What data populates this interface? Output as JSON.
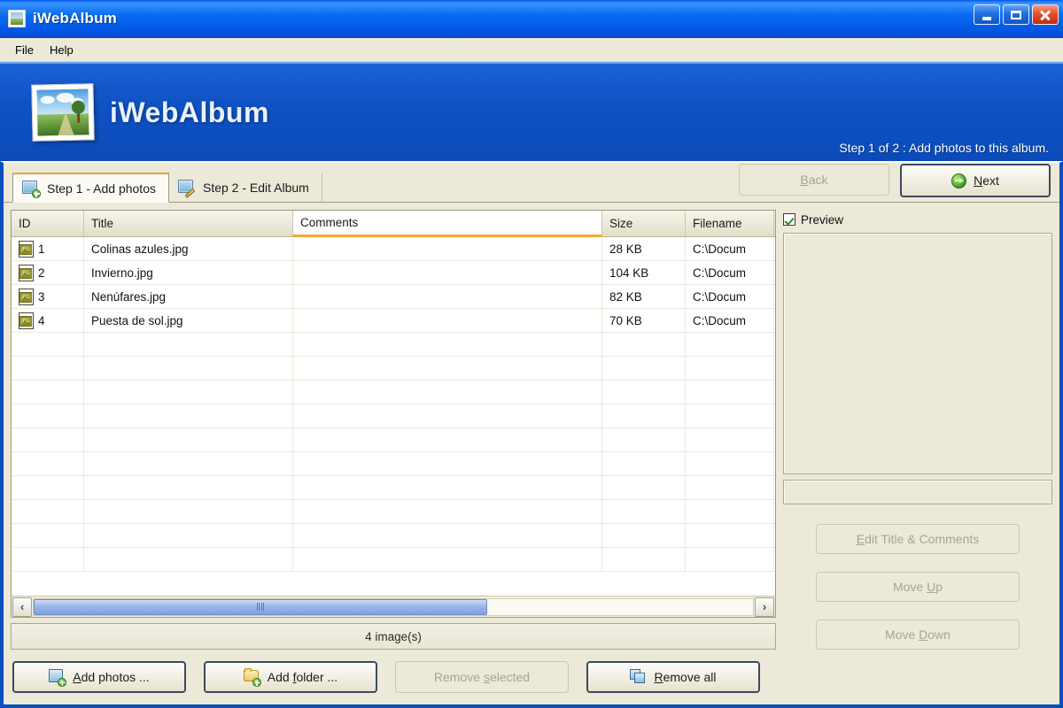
{
  "window": {
    "title": "iWebAlbum",
    "icon": "photo-icon",
    "controls": {
      "minimize": "minimize-icon",
      "maximize": "maximize-icon",
      "close": "close-icon"
    }
  },
  "menubar": {
    "items": [
      {
        "label": "File"
      },
      {
        "label": "Help"
      }
    ]
  },
  "banner": {
    "app_name": "iWebAlbum",
    "logo": "photo-frame-logo",
    "step_text": "Step 1 of 2 : Add photos to this album."
  },
  "tabs": [
    {
      "label": "Step 1 - Add photos",
      "icon": "image-add-icon",
      "active": true
    },
    {
      "label": "Step 2 - Edit Album",
      "icon": "image-edit-icon",
      "active": false
    }
  ],
  "nav": {
    "back": {
      "label": "Back",
      "accel": "B",
      "enabled": false
    },
    "next": {
      "label": "Next",
      "accel": "N",
      "enabled": true,
      "icon": "green-arrow-right-icon",
      "default": true
    }
  },
  "grid": {
    "columns": [
      {
        "key": "id",
        "label": "ID"
      },
      {
        "key": "title",
        "label": "Title"
      },
      {
        "key": "comments",
        "label": "Comments",
        "hover": true
      },
      {
        "key": "size",
        "label": "Size"
      },
      {
        "key": "filename",
        "label": "Filename"
      }
    ],
    "rows": [
      {
        "icon": "jpg-file-icon",
        "id": "1",
        "title": "Colinas azules.jpg",
        "comments": "",
        "size": "28 KB",
        "filename": "C:\\Docum"
      },
      {
        "icon": "jpg-file-icon",
        "id": "2",
        "title": "Invierno.jpg",
        "comments": "",
        "size": "104 KB",
        "filename": "C:\\Docum"
      },
      {
        "icon": "jpg-file-icon",
        "id": "3",
        "title": "Nenúfares.jpg",
        "comments": "",
        "size": "82 KB",
        "filename": "C:\\Docum"
      },
      {
        "icon": "jpg-file-icon",
        "id": "4",
        "title": "Puesta de sol.jpg",
        "comments": "",
        "size": "70 KB",
        "filename": "C:\\Docum"
      }
    ],
    "empty_row_count": 10,
    "scrollbar": {
      "left_arrow": "‹",
      "right_arrow": "›",
      "thumb_percent": 63
    }
  },
  "status": {
    "text": "4 image(s)"
  },
  "preview": {
    "checkbox_label": "Preview",
    "checked": true,
    "image": "",
    "caption": ""
  },
  "side_buttons": [
    {
      "label": "Edit Title & Comments",
      "accel": "E",
      "enabled": false,
      "name": "edit-title-comments-button"
    },
    {
      "label": "Move Up",
      "accel": "U",
      "enabled": false,
      "name": "move-up-button"
    },
    {
      "label": "Move Down",
      "accel": "D",
      "enabled": false,
      "name": "move-down-button"
    }
  ],
  "bottom_buttons": [
    {
      "label": "Add photos ...",
      "accel": "A",
      "enabled": true,
      "icon": "image-add-icon",
      "name": "add-photos-button"
    },
    {
      "label": "Add folder ...",
      "accel": "f",
      "enabled": true,
      "icon": "folder-add-icon",
      "name": "add-folder-button"
    },
    {
      "label": "Remove selected",
      "accel": "s",
      "enabled": false,
      "icon": "",
      "name": "remove-selected-button"
    },
    {
      "label": "Remove all",
      "accel": "R",
      "enabled": true,
      "icon": "images-stack-icon",
      "name": "remove-all-button"
    }
  ],
  "colors": {
    "titlebar_blue": "#0058ee",
    "frame_blue": "#0a4fbf",
    "panel_beige": "#ece9d8",
    "accent_orange": "#f0a92c",
    "green_badge": "#3e9420",
    "scroll_thumb_blue": "#9cb6e8"
  }
}
